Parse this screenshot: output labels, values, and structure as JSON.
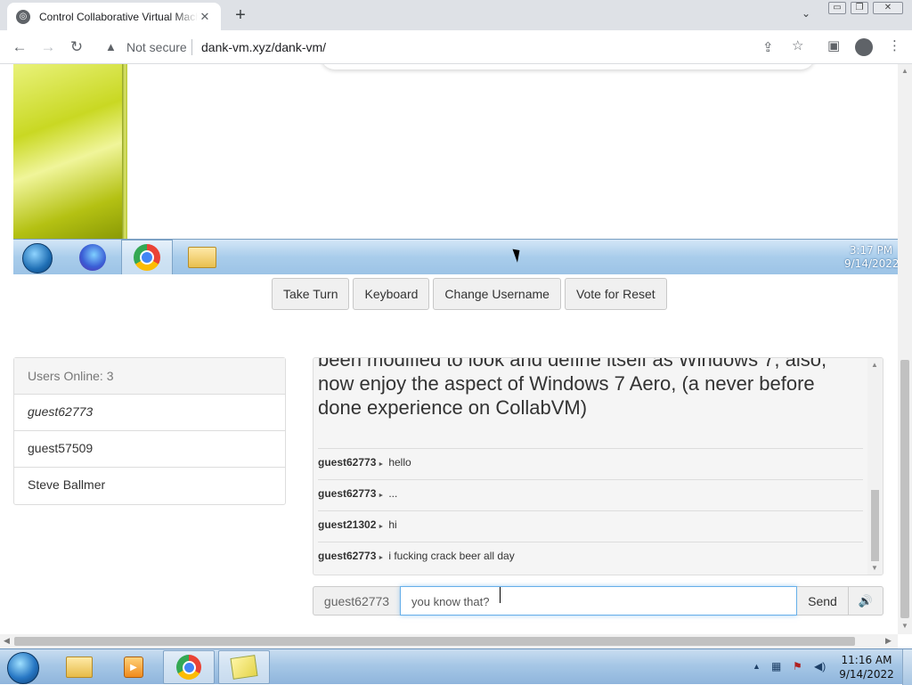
{
  "browser": {
    "tab_title": "Control Collaborative Virtual Machine",
    "tab_close": "✕",
    "new_tab": "+",
    "security_label": "Not secure",
    "url": "dank-vm.xyz/dank-vm/",
    "window_controls": [
      "▭",
      "❐",
      "✕"
    ]
  },
  "vm": {
    "clock_time": "3:17 PM",
    "clock_date": "9/14/2022"
  },
  "vm_buttons": {
    "take_turn": "Take Turn",
    "keyboard": "Keyboard",
    "change_username": "Change Username",
    "vote_reset": "Vote for Reset"
  },
  "users": {
    "header": "Users Online: 3",
    "list": [
      "guest62773",
      "guest57509",
      "Steve Ballmer"
    ]
  },
  "chat": {
    "motd_partial": "been modified to look and define itself as Windows 7, also, now enjoy the aspect of Windows 7 Aero, (a never before done experience on CollabVM)",
    "messages": [
      {
        "user": "guest62773",
        "text": "hello"
      },
      {
        "user": "guest62773",
        "text": "..."
      },
      {
        "user": "guest21302",
        "text": "hi"
      },
      {
        "user": "guest62773",
        "text": "i fucking crack beer all day"
      }
    ],
    "arrow": "►"
  },
  "chat_input": {
    "username": "guest62773",
    "value": "you know that?",
    "send_label": "Send",
    "volume_icon": "🔊"
  },
  "host_taskbar": {
    "clock_time": "11:16 AM",
    "clock_date": "9/14/2022"
  },
  "icons": {
    "back": "back-arrow-icon",
    "forward": "forward-arrow-icon",
    "reload": "reload-icon",
    "warning": "warning-triangle-icon",
    "share": "share-icon",
    "bookmark": "star-icon",
    "sidepanel": "side-panel-icon",
    "profile": "profile-icon",
    "menu": "kebab-menu-icon"
  }
}
